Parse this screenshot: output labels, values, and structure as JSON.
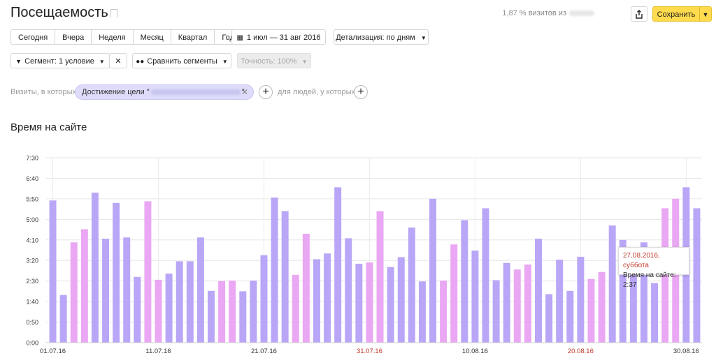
{
  "header": {
    "title": "Посещаемость",
    "visits_info": "1,87 % визитов из",
    "save_label": "Сохранить"
  },
  "toolbar": {
    "periods": [
      "Сегодня",
      "Вчера",
      "Неделя",
      "Месяц",
      "Квартал",
      "Год"
    ],
    "date_range": "1 июл — 31 авг 2016",
    "detail": "Детализация: по дням",
    "segment": "Сегмент: 1 условие",
    "compare": "Сравнить сегменты",
    "accuracy": "Точность: 100%"
  },
  "filter": {
    "visits_label": "Визиты, в которых",
    "goal_prefix": "Достижение цели \"",
    "goal_suffix": "\"",
    "people_label": "для людей, у которых"
  },
  "chart_title": "Время на сайте",
  "tooltip": {
    "date": "27.08.2016, суббота",
    "value": "Время на сайте: 2:37"
  },
  "colors": {
    "weekday_bar": "#b9a6f7",
    "weekend_bar": "#eaa7f3",
    "save_button": "#ffdb4d",
    "weekend_tick": "#c0392b"
  },
  "chart_data": {
    "type": "bar",
    "title": "Время на сайте",
    "ylabel": "",
    "xlabel": "",
    "ylim": [
      "0:00",
      "7:30"
    ],
    "y_ticks": [
      "0:00",
      "0:50",
      "1:40",
      "2:30",
      "3:20",
      "4:10",
      "5:00",
      "5:50",
      "6:40",
      "7:30"
    ],
    "x_ticks": [
      {
        "label": "01.07.16",
        "weekend": false
      },
      {
        "label": "11.07.16",
        "weekend": false
      },
      {
        "label": "21.07.16",
        "weekend": false
      },
      {
        "label": "31.07.16",
        "weekend": true
      },
      {
        "label": "10.08.16",
        "weekend": false
      },
      {
        "label": "20.08.16",
        "weekend": true
      },
      {
        "label": "30.08.16",
        "weekend": false
      }
    ],
    "categories": [
      "01.07",
      "02.07",
      "03.07",
      "04.07",
      "05.07",
      "06.07",
      "07.07",
      "08.07",
      "09.07",
      "10.07",
      "11.07",
      "12.07",
      "13.07",
      "14.07",
      "15.07",
      "16.07",
      "17.07",
      "18.07",
      "19.07",
      "20.07",
      "21.07",
      "22.07",
      "23.07",
      "24.07",
      "25.07",
      "26.07",
      "27.07",
      "28.07",
      "29.07",
      "30.07",
      "31.07",
      "01.08",
      "02.08",
      "03.08",
      "04.08",
      "05.08",
      "06.08",
      "07.08",
      "08.08",
      "09.08",
      "10.08",
      "11.08",
      "12.08",
      "13.08",
      "14.08",
      "15.08",
      "16.08",
      "17.08",
      "18.08",
      "19.08",
      "20.08",
      "21.08",
      "22.08",
      "23.08",
      "24.08",
      "25.08",
      "26.08",
      "27.08",
      "28.08",
      "29.08",
      "30.08",
      "31.08"
    ],
    "series": [
      {
        "values": [
          "5:46",
          "1:56",
          "4:04",
          "4:36",
          "6:05",
          "4:13",
          "5:40",
          "4:16",
          "2:40",
          "5:44",
          "2:33",
          "2:48",
          "3:18",
          "3:18",
          "4:16",
          "2:06",
          "2:30",
          "2:31",
          "2:05",
          "2:31",
          "3:33",
          "5:53",
          "5:20",
          "2:45",
          "4:25",
          "3:23",
          "3:37",
          "6:18",
          "4:14",
          "3:12",
          "3:15",
          "5:20",
          "3:04",
          "3:28",
          "4:40",
          "2:29",
          "5:50",
          "2:31",
          "3:59",
          "4:58",
          "3:44",
          "5:27",
          "2:32",
          "3:14",
          "2:58",
          "3:10",
          "4:13",
          "1:58",
          "3:22",
          "2:06",
          "3:29",
          "2:35",
          "2:52",
          "4:45",
          "4:10",
          "3:43",
          "4:04",
          "2:25",
          "5:27",
          "5:50",
          "6:18",
          "5:27"
        ]
      }
    ],
    "weekend": [
      false,
      false,
      true,
      true,
      false,
      false,
      false,
      false,
      false,
      true,
      true,
      false,
      false,
      false,
      false,
      false,
      true,
      true,
      false,
      false,
      false,
      false,
      false,
      true,
      true,
      false,
      false,
      false,
      false,
      false,
      true,
      true,
      false,
      false,
      false,
      false,
      false,
      true,
      true,
      false,
      false,
      false,
      false,
      false,
      true,
      true,
      false,
      false,
      false,
      false,
      false,
      true,
      true,
      false,
      false,
      false,
      false,
      false,
      true,
      true,
      false,
      false
    ]
  }
}
